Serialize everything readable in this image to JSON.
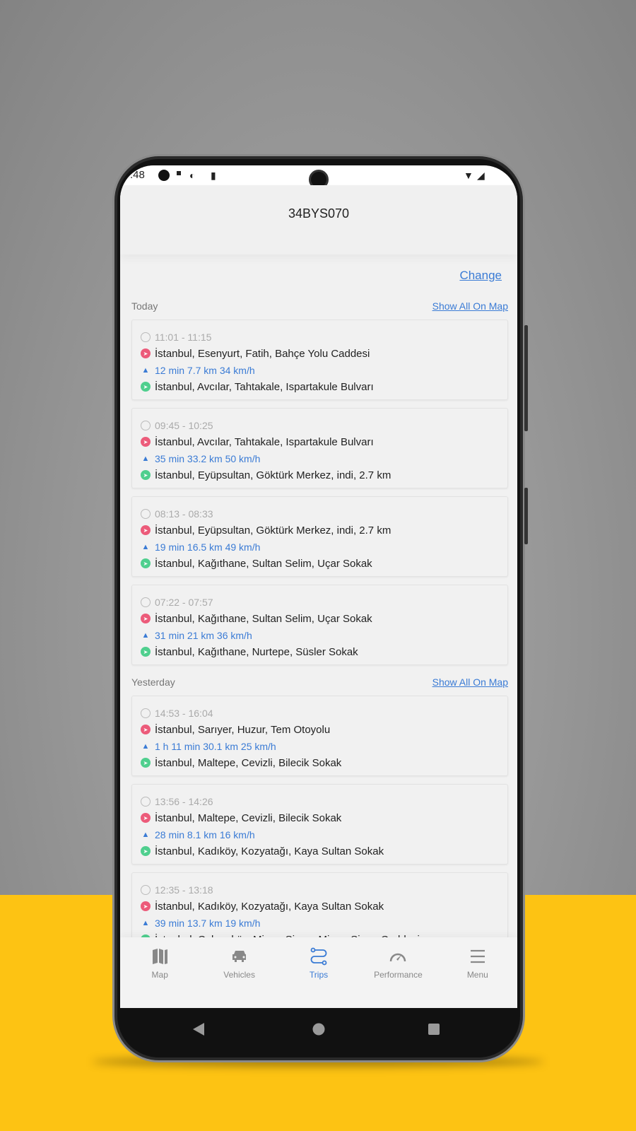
{
  "status_bar": {
    "time": ".48"
  },
  "header": {
    "title": "34BYS070"
  },
  "change_label": "Change",
  "accent": "#3a7bd5",
  "start_color": "#ec5b7a",
  "end_color": "#4fcf8e",
  "sections": [
    {
      "label": "Today",
      "link": "Show All On Map",
      "trips": [
        {
          "time": "11:01 - 11:15",
          "from": "İstanbul, Esenyurt, Fatih, Bahçe Yolu Caddesi",
          "stats": "12 min 7.7 km 34 km/h",
          "to": "İstanbul, Avcılar, Tahtakale, Ispartakule Bulvarı"
        },
        {
          "time": "09:45 - 10:25",
          "from": "İstanbul, Avcılar, Tahtakale, Ispartakule Bulvarı",
          "stats": "35 min 33.2 km 50 km/h",
          "to": "İstanbul, Eyüpsultan, Göktürk Merkez, indi, 2.7 km"
        },
        {
          "time": "08:13 - 08:33",
          "from": "İstanbul, Eyüpsultan, Göktürk Merkez, indi, 2.7 km",
          "stats": "19 min 16.5 km 49 km/h",
          "to": "İstanbul, Kağıthane, Sultan Selim, Uçar Sokak"
        },
        {
          "time": "07:22 - 07:57",
          "from": "İstanbul, Kağıthane, Sultan Selim, Uçar Sokak",
          "stats": "31 min 21 km 36 km/h",
          "to": "İstanbul, Kağıthane, Nurtepe, Süsler Sokak"
        }
      ]
    },
    {
      "label": "Yesterday",
      "link": "Show All On Map",
      "trips": [
        {
          "time": "14:53 - 16:04",
          "from": "İstanbul, Sarıyer, Huzur, Tem Otoyolu",
          "stats": "1 h 11 min 30.1 km 25 km/h",
          "to": "İstanbul, Maltepe, Cevizli, Bilecik Sokak"
        },
        {
          "time": "13:56 - 14:26",
          "from": "İstanbul, Maltepe, Cevizli, Bilecik Sokak",
          "stats": "28 min 8.1 km 16 km/h",
          "to": "İstanbul, Kadıköy, Kozyatağı, Kaya Sultan Sokak"
        },
        {
          "time": "12:35 - 13:18",
          "from": "İstanbul, Kadıköy, Kozyatağı, Kaya Sultan Sokak",
          "stats": "39 min 13.7 km 19 km/h",
          "to": "İstanbul, Çekmeköy, Mimar Sinan, Mimar Sinan Caddesi"
        }
      ]
    }
  ],
  "nav": [
    {
      "label": "Map",
      "icon": "map-icon"
    },
    {
      "label": "Vehicles",
      "icon": "car-icon"
    },
    {
      "label": "Trips",
      "icon": "route-icon",
      "active": true
    },
    {
      "label": "Performance",
      "icon": "speedometer-icon"
    },
    {
      "label": "Menu",
      "icon": "hamburger-icon"
    }
  ]
}
